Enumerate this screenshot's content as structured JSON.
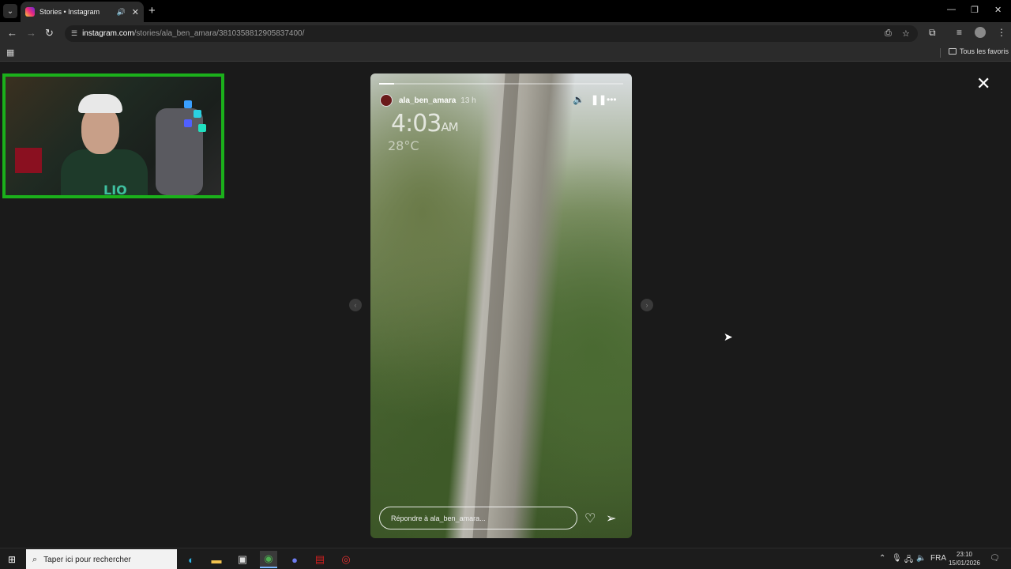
{
  "browser": {
    "tab": {
      "title": "Stories • Instagram"
    },
    "address": {
      "host": "instagram.com",
      "path": "/stories/ala_ben_amara/3810358812905837400/"
    },
    "bookmarks": {
      "folder_label": "Tous les favoris"
    }
  },
  "story": {
    "username": "ala_ben_amara",
    "time_ago": "13 h",
    "progress": 0.06,
    "sticker_time": "4:03",
    "sticker_ampm": "AM",
    "sticker_temp": "28°C",
    "reply_placeholder": "Répondre à ala_ben_amara..."
  },
  "webcam": {
    "sign_text": "LIO"
  },
  "taskbar": {
    "search_placeholder": "Taper ici pour rechercher",
    "language": "FRA",
    "time": "23:10",
    "date": "15/01/2026"
  },
  "colors": {
    "webcam_border": "#1bb01b",
    "background": "#1a1a1a",
    "instagram_gradient": "#ee2a7b"
  },
  "icons": {
    "tab_favicon": "instagram-icon",
    "speaker": "speaker-icon",
    "close": "close-icon",
    "back": "back-arrow-icon",
    "forward": "forward-arrow-icon",
    "reload": "reload-icon",
    "install": "install-app-icon",
    "star": "bookmark-star-icon",
    "extensions": "puzzle-icon",
    "media": "media-control-icon",
    "menu": "kebab-menu-icon",
    "apps": "apps-grid-icon",
    "story_mute": "volume-icon",
    "story_pause": "pause-icon",
    "story_more": "more-icon",
    "like": "heart-icon",
    "share": "send-icon"
  }
}
